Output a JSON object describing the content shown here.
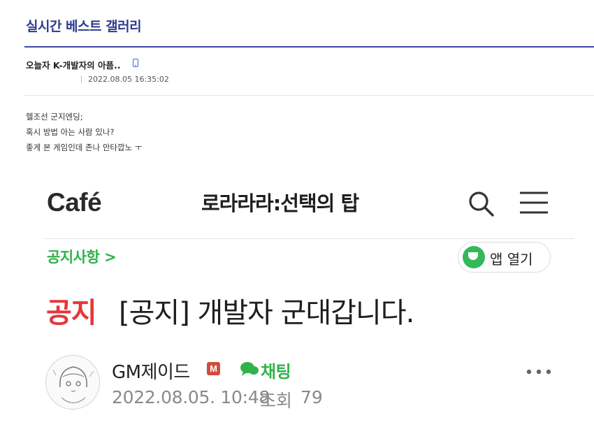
{
  "gallery": {
    "title": "실시간 베스트 갤러리"
  },
  "post": {
    "title": "오늘자 K-개발자의 아픔..",
    "date": "2022.08.05 16:35:02",
    "body_lines": [
      "헬조선 군지엔딩;",
      "혹시 방법 아는 사람 있나?",
      "좋게 본 게임인데 존나 안타깝노 ㅜ"
    ]
  },
  "cafe": {
    "logo": "Café",
    "name": "로라라라:선택의 탑",
    "notice_link": "공지사항 >",
    "app_open": "앱 열기",
    "notice_tag": "공지",
    "notice_title": "[공지] 개발자 군대갑니다.",
    "author": "GM제이드",
    "author_badge": "M",
    "chat": "채팅",
    "post_date": "2022.08.05. 10:48",
    "views_label": "조회",
    "views_count": "79"
  },
  "colors": {
    "accent_blue": "#2b3a8e",
    "cafe_green": "#2fb34a",
    "notice_red": "#e5373a"
  },
  "icons": [
    "mobile-icon",
    "search-icon",
    "menu-icon",
    "app-open-icon",
    "manager-badge",
    "chat-icon",
    "more-icon",
    "avatar"
  ]
}
